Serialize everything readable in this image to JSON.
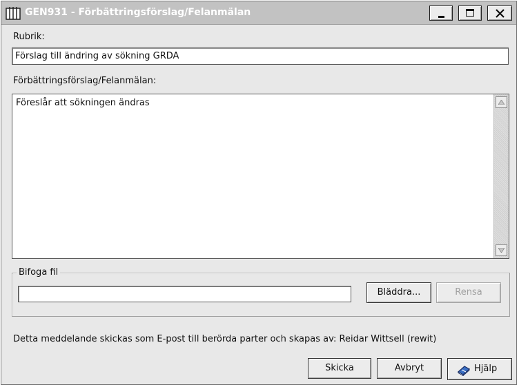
{
  "window": {
    "title": "GEN931 - Förbättringsförslag/Felanmälan"
  },
  "form": {
    "rubrik_label": "Rubrik:",
    "rubrik_value": "Förslag till ändring av sökning GRDA",
    "description_label": "Förbättringsförslag/Felanmälan:",
    "description_value": "Föreslår att sökningen ändras"
  },
  "attachment": {
    "legend": "Bifoga fil",
    "file_value": "",
    "browse_label": "Bläddra...",
    "clear_label": "Rensa"
  },
  "info": {
    "text": "Detta meddelande skickas som E-post till berörda parter och skapas av: Reidar Wittsell (rewit)"
  },
  "buttons": {
    "send_label": "Skicka",
    "cancel_label": "Avbryt",
    "help_label": "Hjälp"
  },
  "icons": {
    "app": "app-window-icon",
    "help": "help-book-icon"
  }
}
